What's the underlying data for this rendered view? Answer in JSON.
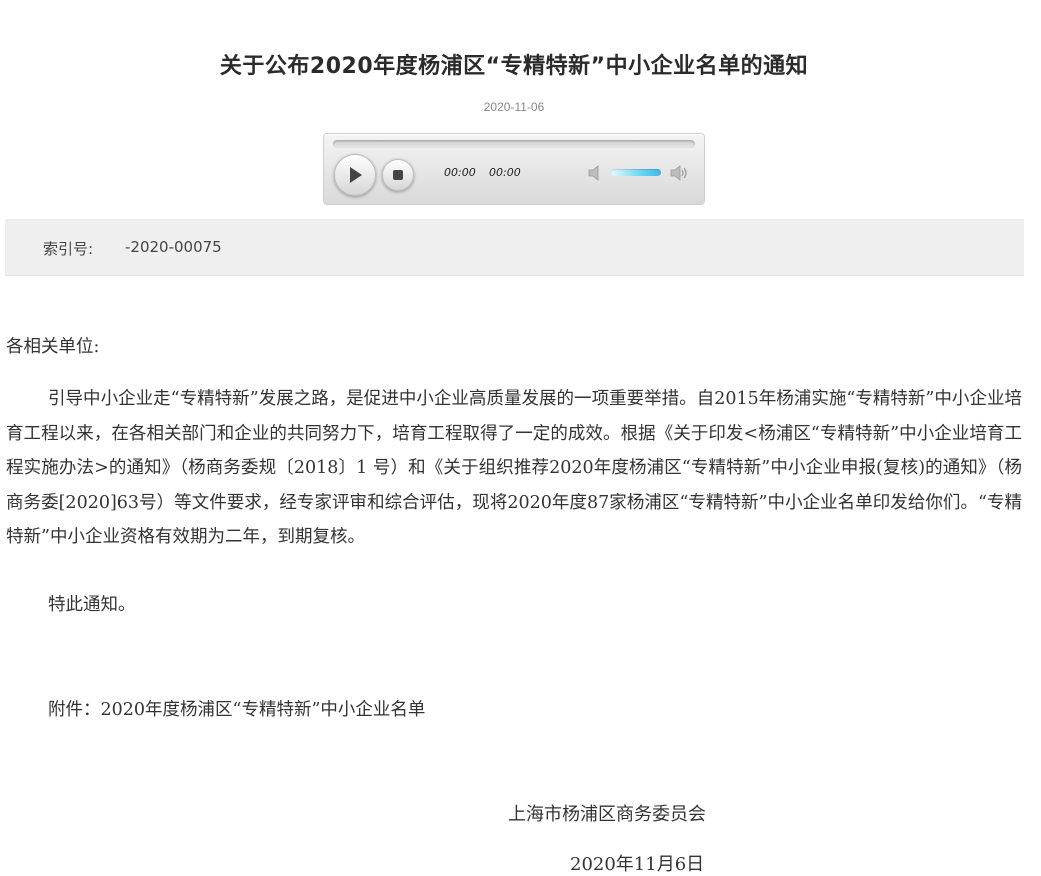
{
  "title": "关于公布2020年度杨浦区“专精特新”中小企业名单的通知",
  "publish_date": "2020-11-06",
  "player": {
    "current_time": "00:00",
    "total_time": "00:00",
    "volume_fraction": 0.8,
    "accent_color": "#3cb8e6"
  },
  "index": {
    "label": "索引号:",
    "value": "-2020-00075"
  },
  "body": {
    "salutation": "各相关单位:",
    "main": "引导中小企业走“专精特新”发展之路，是促进中小企业高质量发展的一项重要举措。自2015年杨浦实施“专精特新”中小企业培育工程以来，在各相关部门和企业的共同努力下，培育工程取得了一定的成效。根据《关于印发<杨浦区“专精特新”中小企业培育工程实施办法>的通知》（杨商务委规〔2018〕1 号）和《关于组织推荐2020年度杨浦区“专精特新”中小企业申报(复核)的通知》（杨商务委[2020]63号）等文件要求，经专家评审和综合评估，现将2020年度87家杨浦区“专精特新”中小企业名单印发给你们。“专精特新”中小企业资格有效期为二年，到期复核。",
    "notice": "特此通知。",
    "attachment": "附件：2020年度杨浦区“专精特新”中小企业名单",
    "signer": "上海市杨浦区商务委员会",
    "sign_date": "2020年11月6日"
  }
}
